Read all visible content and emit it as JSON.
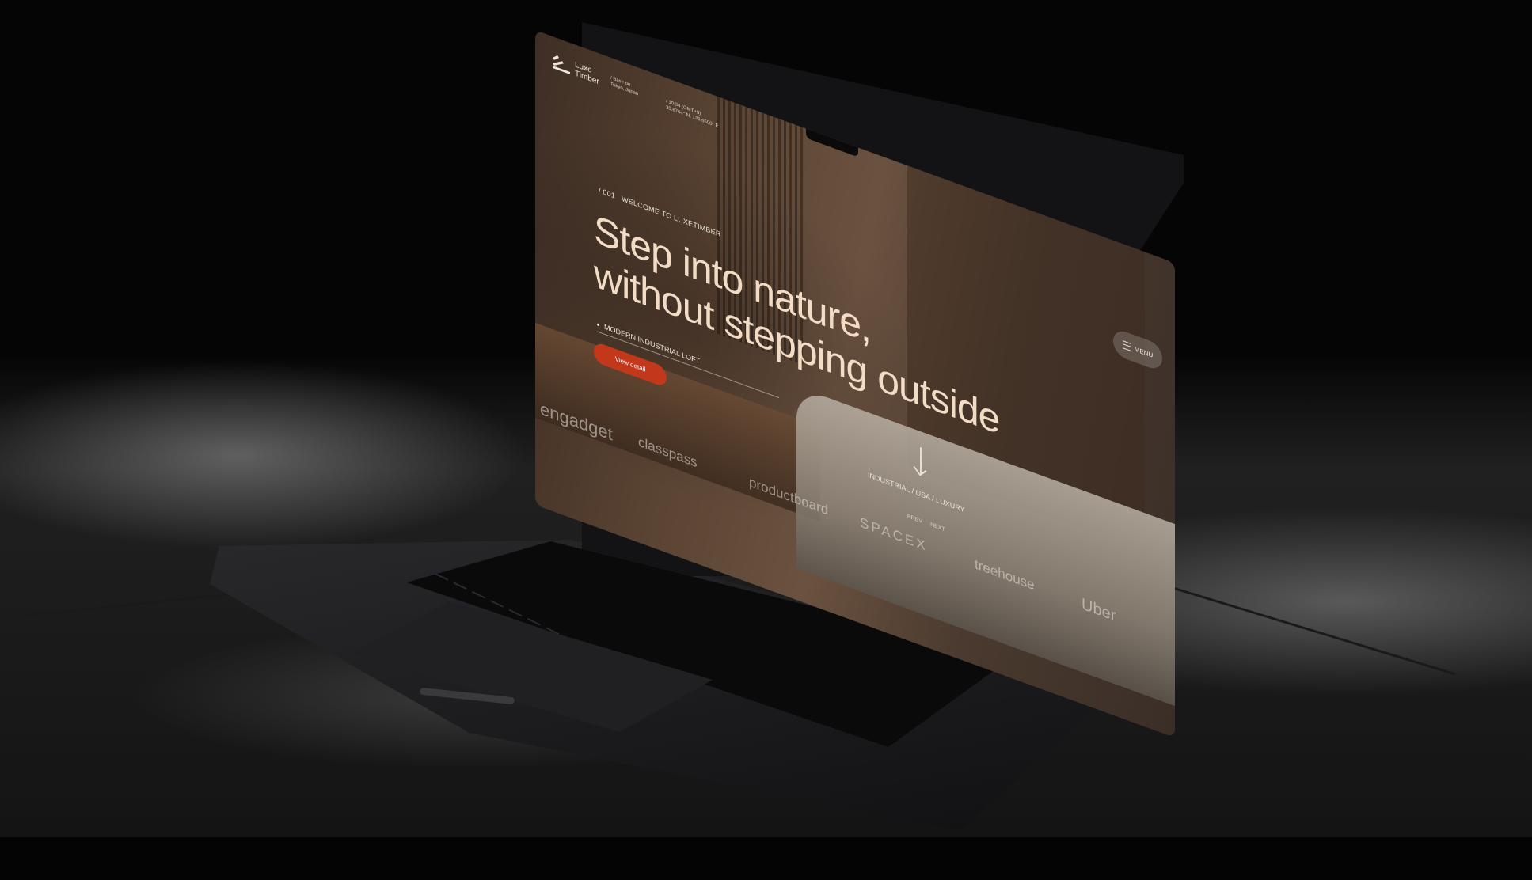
{
  "site": {
    "brand_line1": "Luxe",
    "brand_line2": "Timber",
    "based_label": "/ Base on",
    "based_value": "Tokyo, Japan",
    "time_label": "/ 10:34 (GMT+9)",
    "coords": "35.6764° N, 139.6500° E",
    "menu_label": "MENU"
  },
  "hero": {
    "index": "/ 001",
    "eyebrow": "WELCOME TO LUXETIMBER",
    "headline_line1": "Step into nature,",
    "headline_line2": "without stepping outside",
    "project_name": "MODERN INDUSTRIAL LOFT",
    "cta_label": "View detail",
    "tags": "INDUSTRIAL / USA / LUXURY",
    "prev_label": "PREV",
    "next_label": "NEXT"
  },
  "brands": [
    "engadget",
    "classpass",
    "productboard",
    "SPACEX",
    "treehouse",
    "Uber"
  ],
  "colors": {
    "accent": "#c3371b",
    "headline": "#f2dcc6",
    "background": "#040404"
  },
  "icons": {
    "logo": "luxetimber-logo-icon",
    "menu": "hamburger-icon",
    "scroll": "arrow-down-icon"
  }
}
